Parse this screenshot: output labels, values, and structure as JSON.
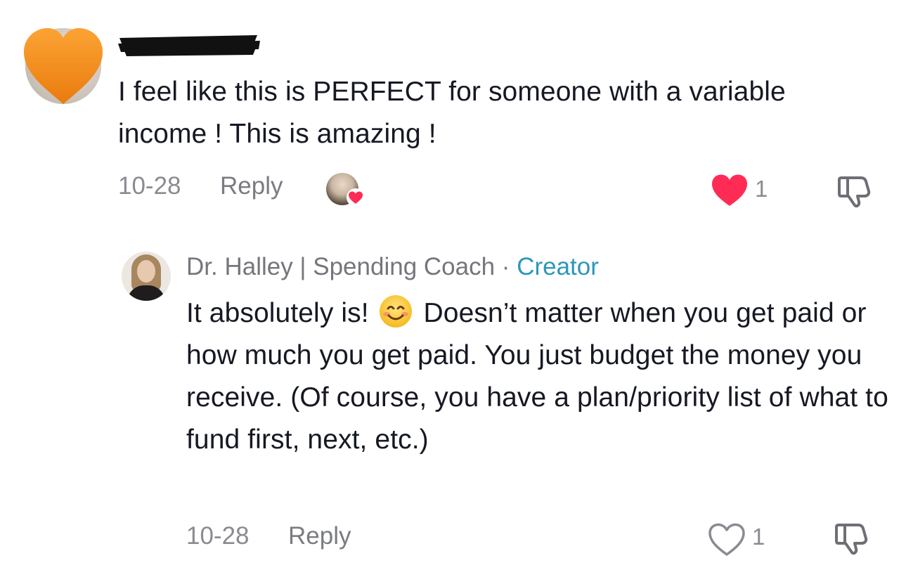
{
  "comment": {
    "text": "I feel like this is PERFECT for someone with a variable income ! This is amazing !",
    "date": "10-28",
    "reply_label": "Reply",
    "like_count": "1",
    "liked": true,
    "creator_liked": true,
    "username_redacted": true
  },
  "reply": {
    "author": "Dr. Halley | Spending Coach",
    "separator": "·",
    "badge": "Creator",
    "text_before_emoji": "It absolutely is!",
    "emoji": "smiling-face-icon",
    "text_after_emoji": "Doesn’t matter when you get paid or how much you get paid. You just budget the money you receive. (Of course, you have a plan/priority list of what to fund first, next, etc.)",
    "date": "10-28",
    "reply_label": "Reply",
    "like_count": "1",
    "liked": false
  },
  "colors": {
    "like_red": "#fe2c55",
    "creator_blue": "#2c98b7",
    "meta_gray": "#8a8b91",
    "avatar_heart_orange": "#f7901e"
  }
}
